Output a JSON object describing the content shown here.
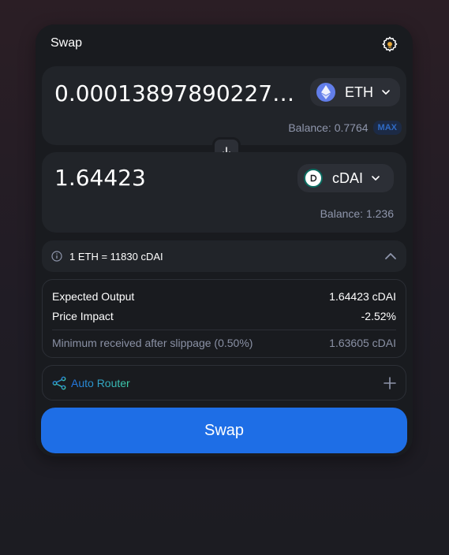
{
  "header": {
    "title": "Swap",
    "settings_icon": "gear-icon"
  },
  "input": {
    "amount": "0.000138978902275...",
    "token": "ETH",
    "token_icon": "ethereum-icon",
    "balance": "Balance: 0.7764",
    "max_label": "MAX"
  },
  "switch_icon": "arrow-down-icon",
  "output": {
    "amount": "1.64423",
    "token": "cDAI",
    "token_icon": "cdai-icon",
    "balance": "Balance: 1.236"
  },
  "rate": {
    "text": "1 ETH = 11830 cDAI"
  },
  "details": {
    "expected_output_label": "Expected Output",
    "expected_output_value": "1.64423 cDAI",
    "price_impact_label": "Price Impact",
    "price_impact_value": "-2.52%",
    "minimum_received_label": "Minimum received after slippage (0.50%)",
    "minimum_received_value": "1.63605 cDAI"
  },
  "router": {
    "label": "Auto Router"
  },
  "swap_button": {
    "label": "Swap"
  },
  "colors": {
    "accent": "#1e6ee6",
    "card": "#191b1f",
    "panel": "#212429",
    "muted_text": "#8f96ac"
  }
}
